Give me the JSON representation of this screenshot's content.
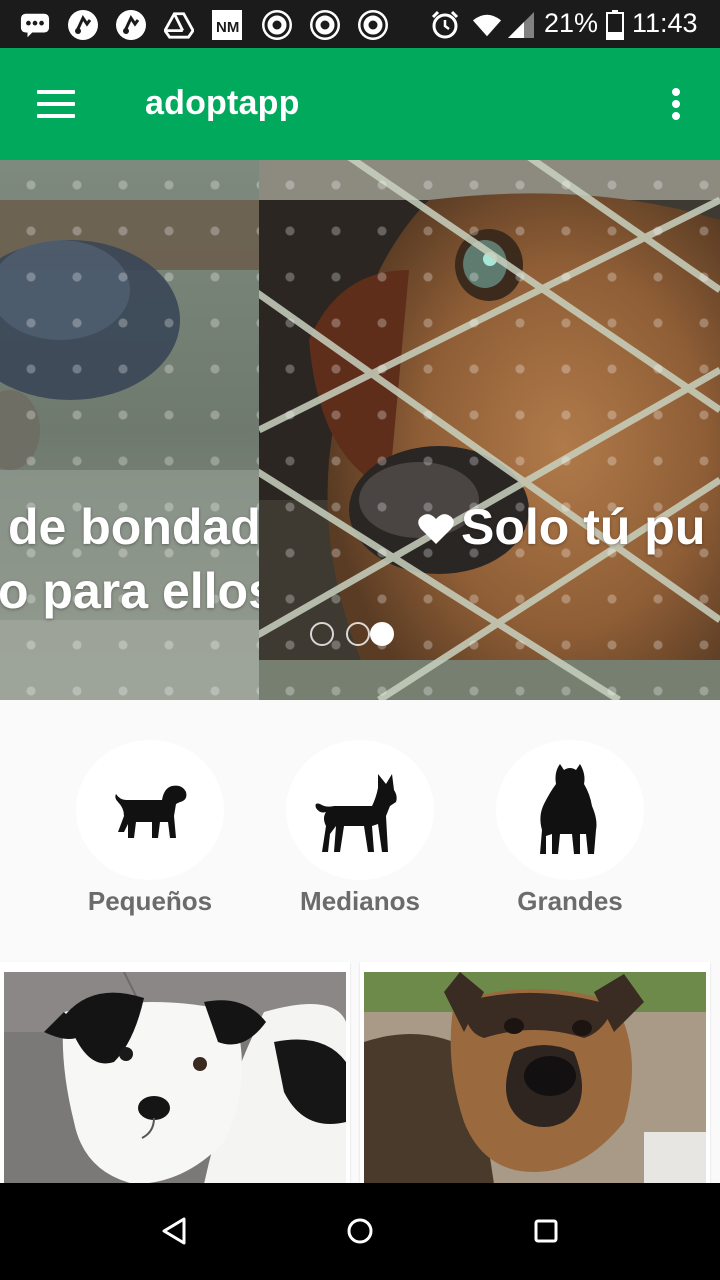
{
  "status_bar": {
    "battery_percent": "21%",
    "time": "11:43",
    "icons": [
      "messages-icon",
      "music-icon",
      "music-icon",
      "drive-icon",
      "news-icon",
      "chrome-icon",
      "chrome-icon",
      "chrome-icon",
      "alarm-icon",
      "wifi-icon",
      "signal-icon",
      "battery-icon"
    ]
  },
  "toolbar": {
    "title": "adoptapp",
    "menu_icon": "hamburger-menu-icon",
    "overflow_icon": "more-vert-icon",
    "color": "#00a95c"
  },
  "carousel": {
    "slides": [
      {
        "lines": [
          "de bondad",
          "o para ellos"
        ]
      },
      {
        "text": "Solo tú pu",
        "icon": "heart-icon"
      }
    ],
    "page_count": 3,
    "active_index": 2
  },
  "categories": [
    {
      "label": "Pequeños",
      "icon": "small-dog-icon"
    },
    {
      "label": "Medianos",
      "icon": "medium-dog-icon"
    },
    {
      "label": "Grandes",
      "icon": "large-dog-icon"
    }
  ],
  "pets": [
    {
      "photo": "black-white-terrier-photo"
    },
    {
      "photo": "german-shepherd-photo"
    }
  ],
  "nav_bar": {
    "buttons": [
      "back-icon",
      "home-icon",
      "recents-icon"
    ]
  }
}
